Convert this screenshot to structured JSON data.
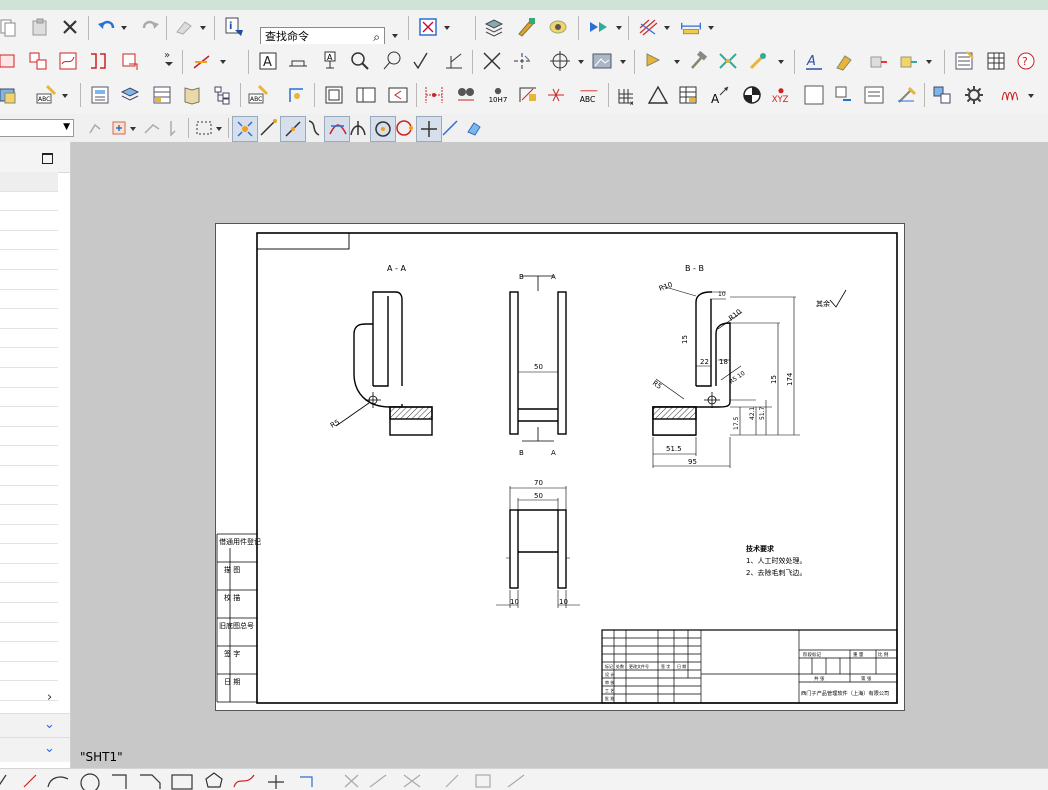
{
  "toolbar": {
    "command_search_placeholder": "查找命令",
    "command_search_icon": "magnifier-icon",
    "part_navigator_combo_value": ""
  },
  "drawing": {
    "sheet_name": "\"SHT1\"",
    "views": {
      "section_aa_label": "A - A",
      "section_bb_label": "B - B",
      "front_view_label_b_left": "B",
      "front_view_label_a_right": "A",
      "front_view_label_b_bottom": "B",
      "front_view_label_a_bottom": "A"
    },
    "dimensions": {
      "front_width": "50",
      "top_width_70": "70",
      "top_width_50": "50",
      "top_gap_left": "10",
      "top_gap_right": "10",
      "aa_radius": "R5",
      "bb_r10": "R10",
      "bb_r10_b": "R10",
      "bb_r5": "R5",
      "bb_10": "10",
      "bb_15": "15",
      "bb_22": "22",
      "bb_18": "18",
      "bb_r5_10": "R5 10",
      "bb_15_vertical": "15",
      "bb_174": "174",
      "bb_42_1": "42.1",
      "bb_51_7": "51.7",
      "bb_17_5": "17.5",
      "bb_51_5": "51.5",
      "bb_95": "95"
    },
    "surface_finish_note": "其余",
    "tech_requirements": {
      "title": "技术要求",
      "item1": "1、人工时效处理。",
      "item2": "2、去除毛刺飞边。"
    },
    "left_border_labels": [
      "借通用件登记",
      "描 图",
      "校 描",
      "旧底图总号",
      "签 字",
      "日 期"
    ],
    "title_block": {
      "company": "西门子产品管理软件（上海）有限公司",
      "stage_label": "阶段标记",
      "weight_label": "重 量",
      "scale_label": "比 例",
      "sheets_label": "共 张",
      "sheet_label": "第 张",
      "row_labels": [
        "标记",
        "处数",
        "更改文件号",
        "签 字",
        "日 期"
      ],
      "role_labels": [
        "设 计",
        "审 核",
        "工 艺",
        "批 准"
      ]
    }
  }
}
